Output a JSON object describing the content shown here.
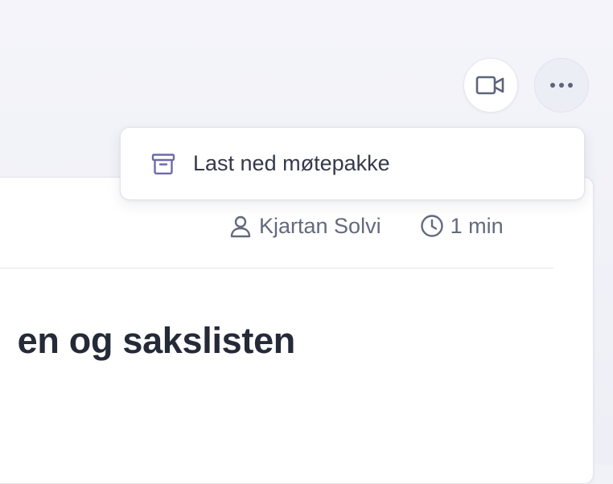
{
  "toolbar": {
    "video_button_icon": "video-camera-icon",
    "more_button_icon": "ellipsis-icon"
  },
  "dropdown": {
    "items": [
      {
        "label": "Last ned møtepakke",
        "icon": "archive-box-icon"
      }
    ]
  },
  "card": {
    "author": "Kjartan Solvi",
    "author_icon": "user-icon",
    "read_time": "1 min",
    "read_time_icon": "clock-icon",
    "title": "en og sakslisten"
  },
  "colors": {
    "background": "#f1f1f8",
    "accent_icon": "#6f6aa8",
    "text_muted": "#636a7e",
    "title_text": "#242a38"
  }
}
